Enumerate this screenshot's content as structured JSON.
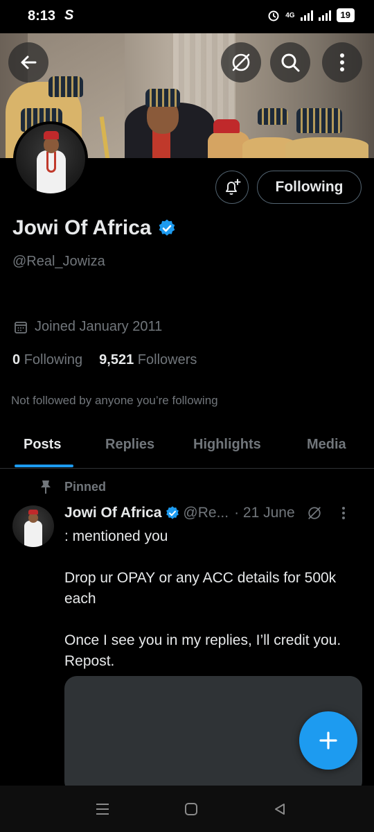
{
  "status_bar": {
    "time": "8:13",
    "app_glyph": "S",
    "network": "4G",
    "battery": "19"
  },
  "header": {
    "back_icon": "arrow-left-icon",
    "grok_icon": "slash-circle-icon",
    "search_icon": "search-icon",
    "more_icon": "more-vertical-icon"
  },
  "profile": {
    "name": "Jowi Of Africa",
    "verified": true,
    "handle": "@Real_Jowiza",
    "joined": "Joined January 2011",
    "following_count": "0",
    "following_label": "Following",
    "followers_count": "9,521",
    "followers_label": "Followers",
    "not_followed_text": "Not followed by anyone you’re following",
    "following_button": "Following"
  },
  "tabs": [
    {
      "label": "Posts",
      "active": true
    },
    {
      "label": "Replies",
      "active": false
    },
    {
      "label": "Highlights",
      "active": false
    },
    {
      "label": "Media",
      "active": false
    }
  ],
  "post": {
    "pinned_label": "Pinned",
    "name": "Jowi Of Africa",
    "handle": "@Re...",
    "date": "· 21 June",
    "body": ": mentioned you\n\nDrop ur OPAY or any ACC details for 500k each\n\nOnce I see you in my replies, I’ll credit you. Repost."
  },
  "colors": {
    "accent": "#1d9bf0",
    "background": "#000000",
    "muted": "#71767b"
  }
}
